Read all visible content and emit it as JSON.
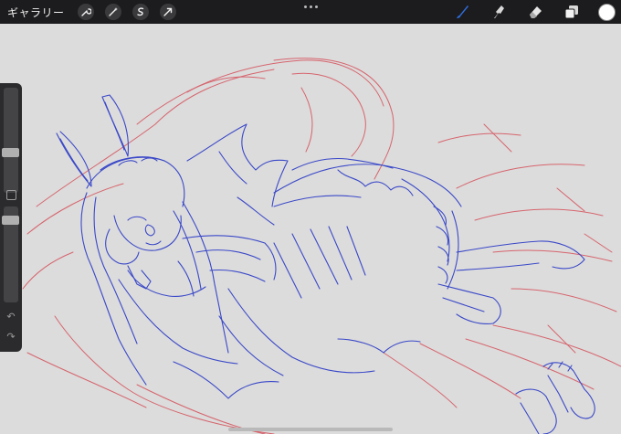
{
  "toolbar": {
    "gallery_label": "ギャラリー",
    "left_tools": [
      "wrench-icon",
      "magic-wand-icon",
      "selection-icon",
      "transform-arrow-icon"
    ],
    "more_icon": "ellipsis-icon",
    "right_tools": [
      "brush-icon",
      "smudge-icon",
      "eraser-icon",
      "layers-icon"
    ],
    "active_tool": "brush-icon",
    "active_color": "#ffffff",
    "accent_color": "#2f6fe0"
  },
  "sidebar": {
    "controls": [
      "brush-size-slider",
      "modify-button",
      "opacity-slider",
      "undo-button",
      "redo-button"
    ]
  },
  "canvas": {
    "background": "#dcdcdc",
    "stroke_colors": {
      "lineart": "#3a48c8",
      "sketch": "#d6505a"
    }
  }
}
